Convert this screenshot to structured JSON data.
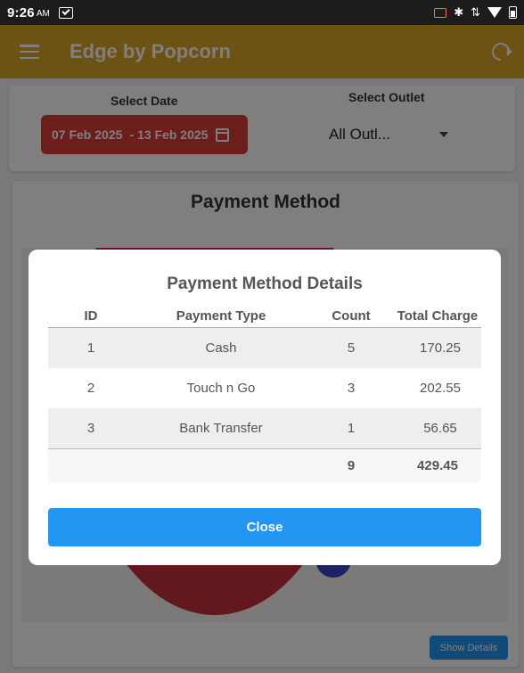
{
  "status_bar": {
    "time": "9:26",
    "ampm": "AM"
  },
  "app_bar": {
    "title": "Edge by Popcorn"
  },
  "filters": {
    "date_label": "Select Date",
    "date_start": "07 Feb 2025",
    "date_sep": "-",
    "date_end": "13 Feb 2025",
    "outlet_label": "Select Outlet",
    "outlet_value": "All Outl..."
  },
  "card": {
    "title": "Payment Method",
    "show_details_label": "Show Details"
  },
  "dialog": {
    "title": "Payment Method Details",
    "columns": [
      "ID",
      "Payment Type",
      "Count",
      "Total Charge"
    ],
    "rows": [
      {
        "id": "1",
        "type": "Cash",
        "count": "5",
        "charge": "170.25"
      },
      {
        "id": "2",
        "type": "Touch n Go",
        "count": "3",
        "charge": "202.55"
      },
      {
        "id": "3",
        "type": "Bank Transfer",
        "count": "1",
        "charge": "56.65"
      }
    ],
    "total": {
      "count": "9",
      "charge": "429.45"
    },
    "close_label": "Close"
  },
  "colors": {
    "app_bar": "#d9a426",
    "date_chip": "#d83c34",
    "primary_button": "#2196f3",
    "pie_red": "#c7313b",
    "pie_blue": "#3b46c9"
  }
}
